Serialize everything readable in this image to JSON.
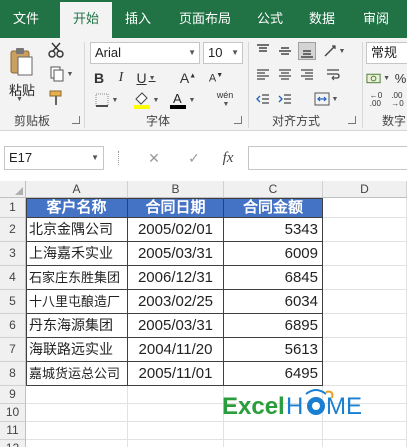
{
  "ribbon_tabs": [
    "文件",
    "开始",
    "插入",
    "页面布局",
    "公式",
    "数据",
    "审阅"
  ],
  "active_tab": "开始",
  "ribbon": {
    "paste_label": "粘贴",
    "font_name": "Arial",
    "font_size": "10",
    "number_format": "常规",
    "groups": [
      "剪贴板",
      "字体",
      "对齐方式",
      "数字"
    ],
    "buttons": [
      "cut-icon",
      "copy-icon",
      "format-painter-icon",
      "bold-icon",
      "italic-icon",
      "underline-icon",
      "border-icon",
      "fill-color-icon",
      "font-color-icon",
      "phonetic-icon",
      "grow-font-icon",
      "shrink-font-icon",
      "align-top-icon",
      "align-middle-icon",
      "align-bottom-icon",
      "align-left-icon",
      "align-center-icon",
      "align-right-icon",
      "orientation-icon",
      "decrease-indent-icon",
      "increase-indent-icon",
      "wrap-text-icon",
      "merge-icon",
      "currency-icon",
      "percent-icon",
      "comma-icon",
      "increase-decimal-icon",
      "decrease-decimal-icon"
    ],
    "phonetic_label": "wén",
    "font_color": "#000000",
    "fill_color": "#ffff00",
    "accent": "#217346"
  },
  "formula_bar": {
    "name_box": "E17",
    "cancel_glyph": "✕",
    "enter_glyph": "✓",
    "fx_label": "fx",
    "formula": ""
  },
  "sheet": {
    "columns": [
      "A",
      "B",
      "C",
      "D"
    ],
    "rows": [
      "1",
      "2",
      "3",
      "4",
      "5",
      "6",
      "7",
      "8",
      "9",
      "10",
      "11",
      "12"
    ],
    "header": [
      "客户名称",
      "合同日期",
      "合同金额"
    ],
    "data": [
      [
        "北京金隅公司",
        "2005/02/01",
        "5343"
      ],
      [
        "上海嘉禾实业",
        "2005/03/31",
        "6009"
      ],
      [
        "石家庄东胜集团",
        "2006/12/31",
        "6845"
      ],
      [
        "十八里屯酿造厂",
        "2003/02/25",
        "6034"
      ],
      [
        "丹东海源集团",
        "2005/03/31",
        "6895"
      ],
      [
        "海联路远实业",
        "2004/11/20",
        "5613"
      ],
      [
        "嘉城货运总公司",
        "2005/11/01",
        "6495"
      ]
    ],
    "header_color": "#4472c4"
  },
  "logo": {
    "part1": "Excel",
    "part2": "H",
    "part3": "ME",
    "color1": "#2a9d3c",
    "color2": "#1a7fd1"
  }
}
